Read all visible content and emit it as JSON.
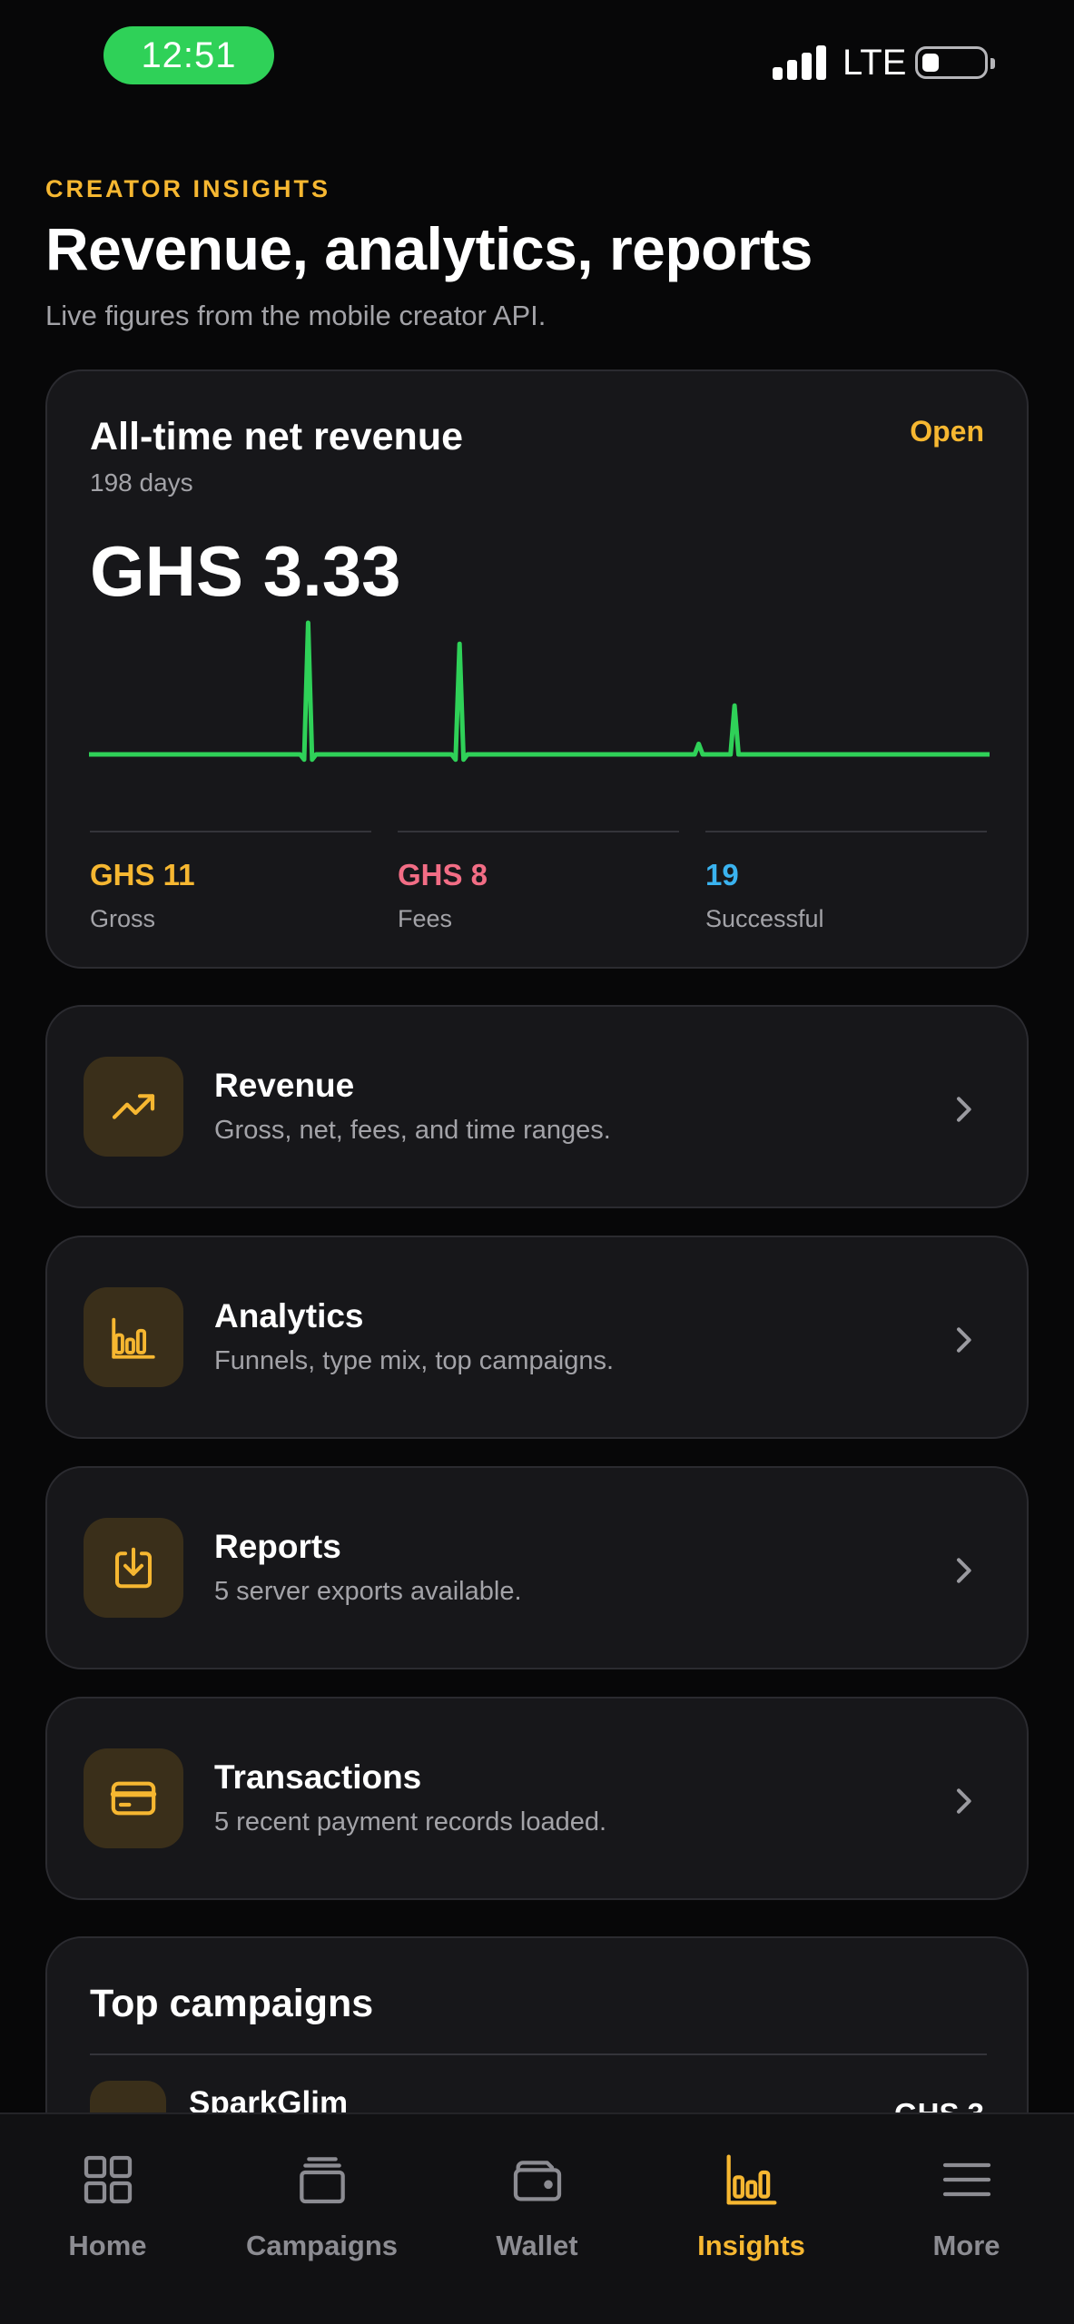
{
  "status_bar": {
    "time": "12:51",
    "network": "LTE"
  },
  "header": {
    "eyebrow": "CREATOR INSIGHTS",
    "title": "Revenue, analytics, reports",
    "subtitle": "Live figures from the mobile creator API."
  },
  "revenue_card": {
    "title": "All-time net revenue",
    "action_label": "Open",
    "period": "198 days",
    "amount": "GHS 3.33",
    "stats": [
      {
        "value": "GHS 11",
        "label": "Gross",
        "color": "#f6b731"
      },
      {
        "value": "GHS 8",
        "label": "Fees",
        "color": "#f26d85"
      },
      {
        "value": "19",
        "label": "Successful",
        "color": "#3ab3f0"
      }
    ],
    "sparkline_color": "#2fd158",
    "sparkline": [
      0,
      0,
      0,
      0,
      0,
      0,
      0,
      0,
      0,
      0,
      0,
      0,
      0,
      0,
      0,
      0,
      0,
      0,
      0,
      0,
      0,
      0,
      0,
      0,
      0,
      0,
      0,
      0,
      0,
      0,
      0,
      0,
      0,
      0,
      0,
      0,
      0,
      0,
      0,
      0,
      0,
      0,
      0,
      0,
      0,
      0,
      0,
      0,
      0,
      0,
      0,
      0,
      0,
      0,
      -0.04,
      1.0,
      -0.04,
      0,
      0,
      0,
      0,
      0,
      0,
      0,
      0,
      0,
      0,
      0,
      0,
      0,
      0,
      0,
      0,
      0,
      0,
      0,
      0,
      0,
      0,
      0,
      0,
      0,
      0,
      0,
      0,
      0,
      0,
      0,
      0,
      0,
      0,
      0,
      -0.04,
      0.84,
      -0.04,
      0,
      0,
      0,
      0,
      0,
      0,
      0,
      0,
      0,
      0,
      0,
      0,
      0,
      0,
      0,
      0,
      0,
      0,
      0,
      0,
      0,
      0,
      0,
      0,
      0,
      0,
      0,
      0,
      0,
      0,
      0,
      0,
      0,
      0,
      0,
      0,
      0,
      0,
      0,
      0,
      0,
      0,
      0,
      0,
      0,
      0,
      0,
      0,
      0,
      0,
      0,
      0,
      0,
      0,
      0,
      0,
      0,
      0,
      0.08,
      0,
      0,
      0,
      0,
      0,
      0,
      0,
      0,
      0.37,
      0,
      0,
      0,
      0,
      0,
      0,
      0,
      0,
      0,
      0,
      0,
      0,
      0,
      0,
      0,
      0,
      0,
      0,
      0,
      0,
      0,
      0,
      0,
      0,
      0,
      0,
      0,
      0,
      0,
      0,
      0,
      0,
      0,
      0,
      0,
      0,
      0,
      0,
      0,
      0,
      0,
      0,
      0,
      0,
      0,
      0,
      0,
      0,
      0,
      0,
      0,
      0,
      0,
      0,
      0,
      0,
      0,
      0,
      0,
      0,
      0,
      0,
      0,
      0
    ]
  },
  "menu": [
    {
      "title": "Revenue",
      "description": "Gross, net, fees, and time ranges.",
      "icon": "trending-up-icon"
    },
    {
      "title": "Analytics",
      "description": "Funnels, type mix, top campaigns.",
      "icon": "bar-chart-icon"
    },
    {
      "title": "Reports",
      "description": "5 server exports available.",
      "icon": "download-icon"
    },
    {
      "title": "Transactions",
      "description": "5 recent payment records loaded.",
      "icon": "credit-card-icon"
    }
  ],
  "top_campaigns": {
    "title": "Top campaigns",
    "items": [
      {
        "name": "SparkGlim",
        "amount": "GHS 3"
      }
    ]
  },
  "nav": {
    "items": [
      {
        "label": "Home",
        "icon": "grid-icon"
      },
      {
        "label": "Campaigns",
        "icon": "layers-icon"
      },
      {
        "label": "Wallet",
        "icon": "wallet-icon"
      },
      {
        "label": "Insights",
        "icon": "bar-chart-icon",
        "active": true
      },
      {
        "label": "More",
        "icon": "menu-icon"
      }
    ]
  },
  "colors": {
    "accent": "#f6b731",
    "background": "#070708",
    "card": "#17171a"
  }
}
